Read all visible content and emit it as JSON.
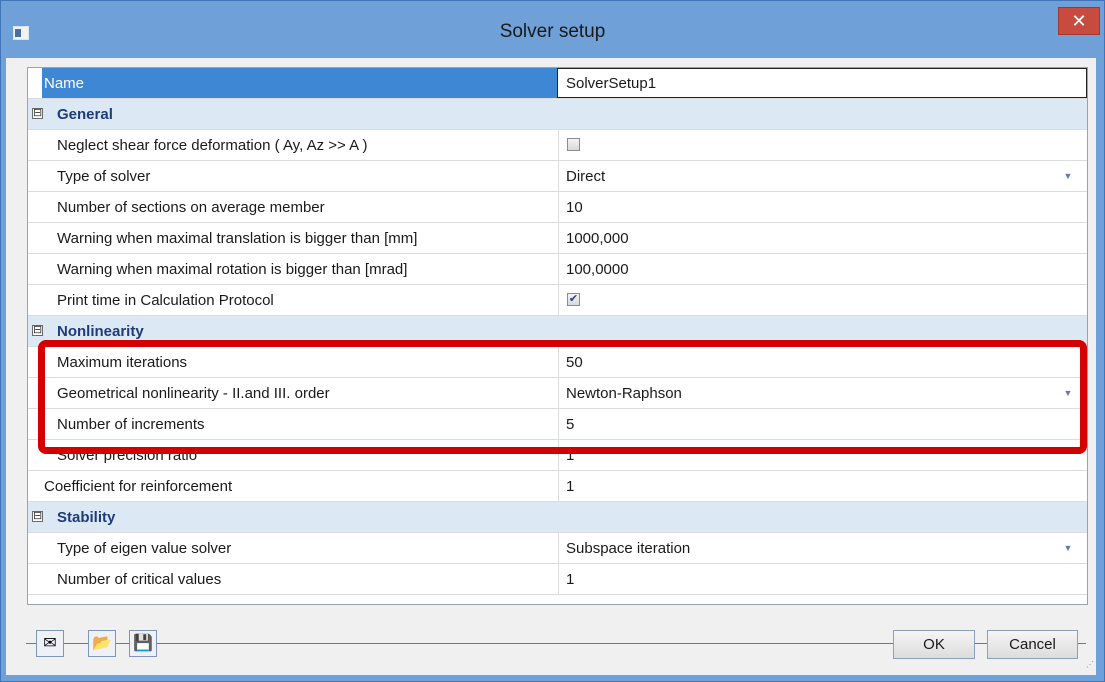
{
  "window": {
    "title": "Solver setup",
    "close_glyph": "✕"
  },
  "name_row": {
    "label": "Name",
    "value": "SolverSetup1"
  },
  "rows": [
    {
      "type": "group",
      "toggle": "⊟",
      "label": "General"
    },
    {
      "type": "check",
      "label": "Neglect shear force deformation ( Ay, Az >> A )",
      "checked": false
    },
    {
      "type": "dropdown",
      "label": "Type of solver",
      "value": "Direct"
    },
    {
      "type": "text",
      "label": "Number of sections on average member",
      "value": "10"
    },
    {
      "type": "text",
      "label": "Warning when maximal translation is bigger than [mm]",
      "value": "1000,000"
    },
    {
      "type": "text",
      "label": "Warning when maximal rotation is bigger than [mrad]",
      "value": "100,0000"
    },
    {
      "type": "check",
      "label": "Print time in Calculation Protocol",
      "checked": true
    },
    {
      "type": "group",
      "toggle": "⊟",
      "label": "Nonlinearity"
    },
    {
      "type": "text",
      "label": "Maximum iterations",
      "value": "50"
    },
    {
      "type": "dropdown",
      "label": "Geometrical nonlinearity - II.and III. order",
      "value": "Newton-Raphson"
    },
    {
      "type": "text",
      "label": "Number of increments",
      "value": "5"
    },
    {
      "type": "text",
      "label": "Solver precision ratio",
      "value": "1"
    },
    {
      "type": "text-outdent",
      "label": "Coefficient for reinforcement",
      "value": "1"
    },
    {
      "type": "group",
      "toggle": "⊟",
      "label": "Stability"
    },
    {
      "type": "dropdown",
      "label": "Type of eigen value solver",
      "value": "Subspace iteration"
    },
    {
      "type": "text",
      "label": "Number of critical values",
      "value": "1"
    }
  ],
  "toolbar": {
    "icons": [
      "envelope-icon",
      "folder-open-icon",
      "save-icon"
    ],
    "glyphs": [
      "✉",
      "📂",
      "💾"
    ]
  },
  "buttons": {
    "ok": "OK",
    "cancel": "Cancel"
  },
  "colors": {
    "highlight": "#d40000",
    "selected": "#3e87d5",
    "group_bg": "#dde8f5",
    "titlebar": "#6fa0d8"
  }
}
